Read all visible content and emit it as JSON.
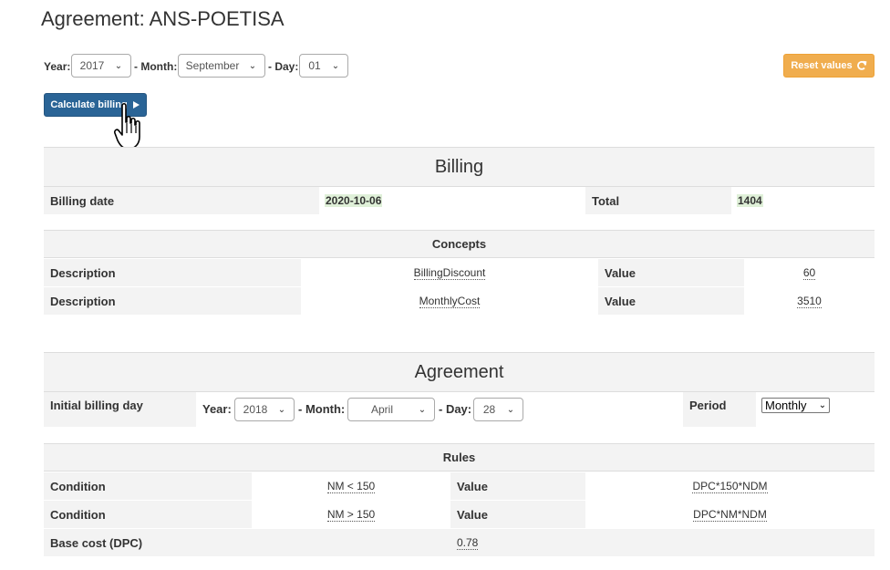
{
  "page": {
    "title": "Agreement: ANS-POETISA"
  },
  "date_picker": {
    "year_label": "Year:",
    "year_value": "2017",
    "month_label": "- Month:",
    "month_value": "September",
    "day_label": "- Day:",
    "day_value": "01"
  },
  "buttons": {
    "reset": "Reset values",
    "calculate": "Calculate billing"
  },
  "billing": {
    "heading": "Billing",
    "date_label": "Billing date",
    "date_value": "2020-10-06",
    "total_label": "Total",
    "total_value": "1404",
    "concepts_heading": "Concepts",
    "concepts": [
      {
        "desc_label": "Description",
        "desc_value": "BillingDiscount",
        "value_label": "Value",
        "value": "60"
      },
      {
        "desc_label": "Description",
        "desc_value": "MonthlyCost",
        "value_label": "Value",
        "value": "3510"
      }
    ]
  },
  "agreement": {
    "heading": "Agreement",
    "initial_label": "Initial billing day",
    "year_label": "Year:",
    "year_value": "2018",
    "month_label": "- Month:",
    "month_value": "April",
    "day_label": "- Day:",
    "day_value": "28",
    "period_label": "Period",
    "period_value": "Monthly",
    "rules_heading": "Rules",
    "rules": [
      {
        "cond_label": "Condition",
        "cond_value": "NM < 150",
        "value_label": "Value",
        "value": "DPC*150*NDM"
      },
      {
        "cond_label": "Condition",
        "cond_value": "NM > 150",
        "value_label": "Value",
        "value": "DPC*NM*NDM"
      }
    ],
    "base_cost_label": "Base cost (DPC)",
    "base_cost_value": "0.78"
  },
  "icons": {
    "refresh": "refresh-icon",
    "play": "play-icon",
    "cursor": "hand-pointer-icon",
    "chevron": "chevron-down-icon"
  }
}
